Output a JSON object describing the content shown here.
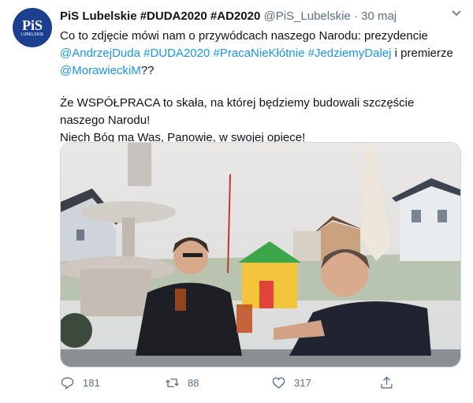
{
  "account": {
    "avatar_text": "PiS",
    "avatar_subtext": "LUBELSKIE",
    "name": "PiS Lubelskie #DUDA2020 #AD2020",
    "handle": "@PiS_Lubelskie",
    "separator": "·",
    "date": "30 maj"
  },
  "tweet": {
    "line1_text": "Co to zdjęcie mówi nam o przywódcach naszego Narodu: prezydencie",
    "mentions_line": [
      "@AndrzejDuda",
      "#DUDA2020",
      "#PracaNieKłótnie",
      "#JedziemyDalej"
    ],
    "line2_tail": " i premierze",
    "mention_morawiecki": "@MorawieckiM",
    "line3_tail": "??",
    "paragraph2": "Że WSPÓŁPRACA to skała, na której będziemy budowali szczęście naszego Narodu!",
    "paragraph3": "Niech Bóg ma Was, Panowie, w swojej opiece!"
  },
  "actions": {
    "replies": "181",
    "retweets": "88",
    "likes": "317"
  },
  "icons": {
    "more": "chevron-down-icon",
    "reply": "reply-icon",
    "retweet": "retweet-icon",
    "like": "heart-icon",
    "share": "share-icon"
  },
  "colors": {
    "link": "#1b95e0",
    "secondary": "#5b7083",
    "avatar_bg": "#1d3f8f"
  }
}
